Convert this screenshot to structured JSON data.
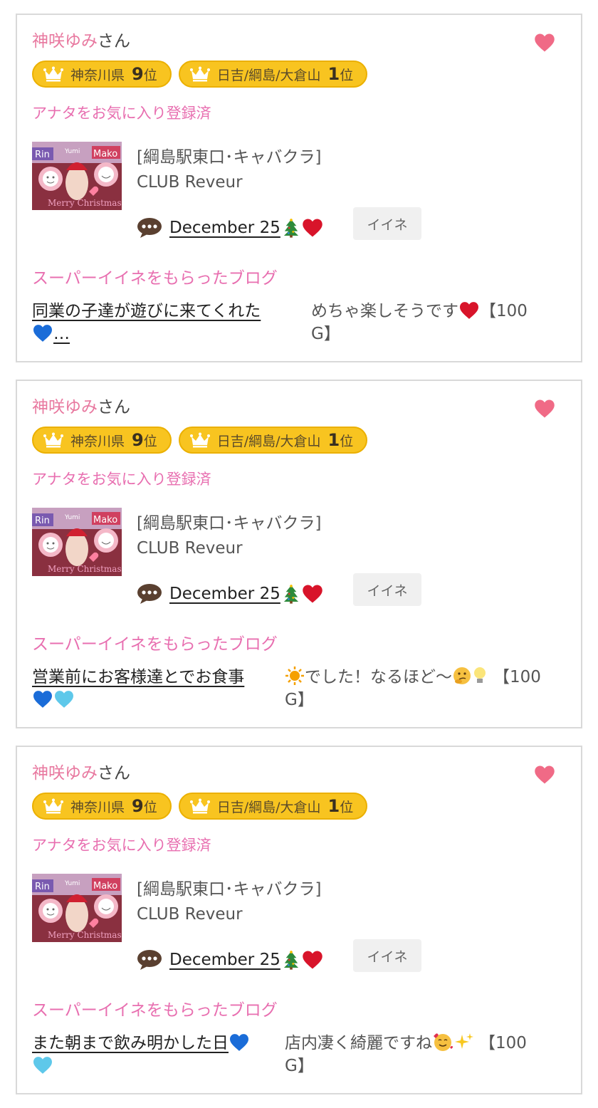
{
  "colors": {
    "pink": "#e8789f",
    "fav_pink": "#e86fb0",
    "badge_yellow": "#f8c420",
    "heart_red": "#d8142a",
    "heart_blue": "#1a6cd8",
    "heart_light_blue": "#5ec8ea"
  },
  "cards": [
    {
      "name": "神咲ゆみ",
      "name_suffix": "さん",
      "fav_icon": "heart-icon",
      "rank_pref": {
        "label": "神奈川県",
        "rank": "9",
        "unit": "位"
      },
      "rank_area": {
        "label": "日吉/綱島/大倉山",
        "rank": "1",
        "unit": "位"
      },
      "fav_status": "アナタをお気に入り登録済",
      "shop_category": "[綱島駅東口･キャバクラ]",
      "shop_name": "CLUB Reveur",
      "thumb_labels": [
        "Rin",
        "Yumi",
        "Mako",
        "Merry Christmas"
      ],
      "blog_title": "December 25 ",
      "like_label": "イイネ",
      "super_like_label": "スーパーイイネをもらったブログ",
      "super_link_text": "同業の子達が遊びに来てくれた",
      "super_link_text2": "…",
      "comment_text": "めちゃ楽しそうです",
      "comment_tail": "【100",
      "comment_line2": "G】"
    },
    {
      "name": "神咲ゆみ",
      "name_suffix": "さん",
      "fav_icon": "heart-icon",
      "rank_pref": {
        "label": "神奈川県",
        "rank": "9",
        "unit": "位"
      },
      "rank_area": {
        "label": "日吉/綱島/大倉山",
        "rank": "1",
        "unit": "位"
      },
      "fav_status": "アナタをお気に入り登録済",
      "shop_category": "[綱島駅東口･キャバクラ]",
      "shop_name": "CLUB Reveur",
      "thumb_labels": [
        "Rin",
        "Yumi",
        "Mako",
        "Merry Christmas"
      ],
      "blog_title": "December 25 ",
      "like_label": "イイネ",
      "super_like_label": "スーパーイイネをもらったブログ",
      "super_link_text": "営業前にお客様達とでお食事",
      "comment_text": "でした！なるほど～",
      "comment_tail": "【100",
      "comment_line2": "G】"
    },
    {
      "name": "神咲ゆみ",
      "name_suffix": "さん",
      "fav_icon": "heart-icon",
      "rank_pref": {
        "label": "神奈川県",
        "rank": "9",
        "unit": "位"
      },
      "rank_area": {
        "label": "日吉/綱島/大倉山",
        "rank": "1",
        "unit": "位"
      },
      "fav_status": "アナタをお気に入り登録済",
      "shop_category": "[綱島駅東口･キャバクラ]",
      "shop_name": "CLUB Reveur",
      "thumb_labels": [
        "Rin",
        "Yumi",
        "Mako",
        "Merry Christmas"
      ],
      "blog_title": "December 25 ",
      "like_label": "イイネ",
      "super_like_label": "スーパーイイネをもらったブログ",
      "super_link_text": "また朝まで飲み明かした日",
      "comment_text": "店内凄く綺麗ですね",
      "comment_tail": "【100",
      "comment_line2": "G】"
    }
  ]
}
